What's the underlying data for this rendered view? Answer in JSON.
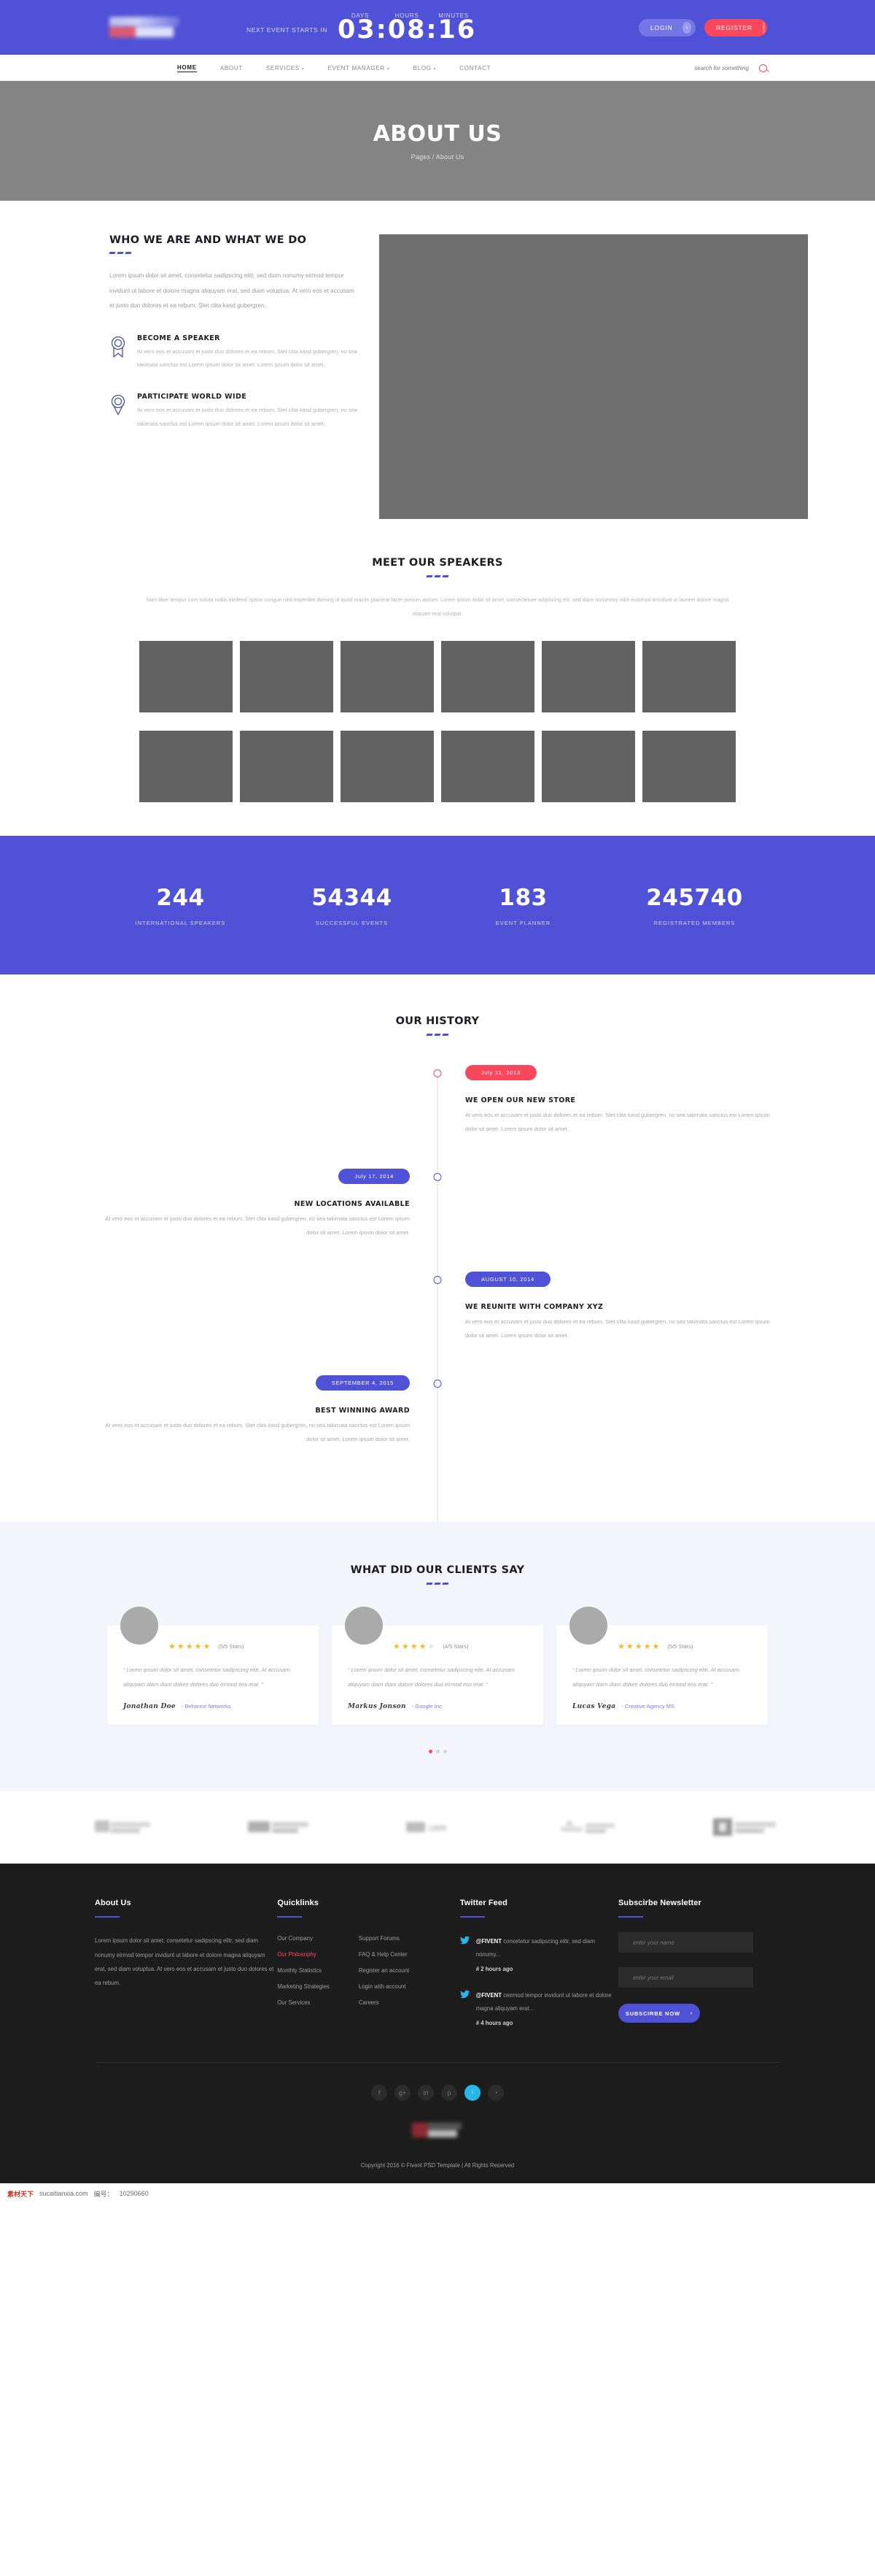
{
  "topbar": {
    "next_event_label": "NEXT EVENT STARTS IN",
    "clock": {
      "days_label": "DAYS",
      "hours_label": "HOURS",
      "minutes_label": "MINUTES",
      "time": "03:08:16"
    },
    "login_label": "LOGIN",
    "register_label": "REGISTER",
    "arrow": "›",
    "brand_color": "#4f51d6",
    "accent_color": "#f9485b"
  },
  "nav": {
    "items": [
      {
        "label": "HOME",
        "caret": "",
        "active": true
      },
      {
        "label": "ABOUT",
        "caret": "",
        "active": false
      },
      {
        "label": "SERVICES",
        "caret": "▾",
        "active": false
      },
      {
        "label": "EVENT MANAGER",
        "caret": "▾",
        "active": false
      },
      {
        "label": "BLOG",
        "caret": "▾",
        "active": false
      },
      {
        "label": "CONTACT",
        "caret": "",
        "active": false
      }
    ],
    "search_placeholder": "search for something"
  },
  "hero": {
    "title": "ABOUT US",
    "breadcrumb": "Pages / About Us"
  },
  "who": {
    "title": "WHO WE ARE AND WHAT WE DO",
    "paragraph": "Lorem ipsum dolor sit amet, consetetur sadipscing elitr, sed diam nonumy eirmod tempor invidunt ut labore et dolore magna aliquyam erat, sed diam voluptua. At vero eos et accusam et justo duo dolores et ea rebum. Stet clita kasd gubergren.",
    "features": [
      {
        "icon": "award-ribbon-icon",
        "title": "BECOME A SPEAKER",
        "text": "At vero eos et accusam et justo duo dolores et ea rebum. Stet clita kasd gubergren, no sea takimata sanctus est Lorem ipsum dolor sit amet. Lorem ipsum dolor sit amet."
      },
      {
        "icon": "map-pin-icon",
        "title": "PARTICIPATE WORLD WIDE",
        "text": "At vero eos et accusam et justo duo dolores et ea rebum. Stet clita kasd gubergren, no sea takimata sanctus est Lorem ipsum dolor sit amet. Lorem ipsum dolor sit amet."
      }
    ]
  },
  "speakers": {
    "title": "MEET OUR SPEAKERS",
    "description": "Nam liber tempor cum soluta nobis eleifend option congue nihil imperdiet doming id quod mazim placerat facer possim assum. Lorem ipsum dolor sit amet, consectetuer adipiscing elit, sed diam nonummy nibh euismod tincidunt ut laoreet dolore magna aliquam erat volutpat.",
    "count": 12
  },
  "counters": [
    {
      "number": "244",
      "label": "INTERNATIONAL SPEAKERS"
    },
    {
      "number": "54344",
      "label": "SUCCESSFUL EVENTS"
    },
    {
      "number": "183",
      "label": "EVENT PLANNER"
    },
    {
      "number": "245740",
      "label": "REGISTRATED MEMBERS"
    }
  ],
  "history": {
    "title": "OUR HISTORY",
    "items": [
      {
        "date": "July 21, 2013",
        "color": "red",
        "side": "right",
        "heading": "WE OPEN OUR NEW STORE",
        "text": "At vero eos et accusam et justo duo dolores et ea rebum. Stet clita kasd gubergren, no sea takimata sanctus est Lorem ipsum dolor sit amet. Lorem ipsum dolor sit amet."
      },
      {
        "date": "July 17, 2014",
        "color": "blue",
        "side": "left",
        "heading": "NEW LOCATIONS AVAILABLE",
        "text": "At vero eos et accusam et justo duo dolores et ea rebum. Stet clita kasd gubergren, no sea takimata sanctus est Lorem ipsum dolor sit amet. Lorem ipsum dolor sit amet."
      },
      {
        "date": "AUGUST 10, 2014",
        "color": "blue",
        "side": "right",
        "heading": "WE REUNITE WITH COMPANY XYZ",
        "text": "At vero eos et accusam et justo duo dolores et ea rebum. Stet clita kasd gubergren, no sea takimata sanctus est Lorem ipsum dolor sit amet. Lorem ipsum dolor sit amet."
      },
      {
        "date": "SEPTEMBER 4, 2015",
        "color": "blue",
        "side": "left",
        "heading": "BEST WINNING AWARD",
        "text": "At vero eos et accusam et justo duo dolores et ea rebum. Stet clita kasd gubergren, no sea takimata sanctus est Lorem ipsum dolor sit amet. Lorem ipsum dolor sit amet."
      }
    ]
  },
  "testimonials": {
    "title": "WHAT DID OUR CLIENTS SAY",
    "items": [
      {
        "stars": 5,
        "rating": "(5/5 Stars)",
        "quote": "“ Lorem ipsum dolor sit amet, consetetur sadipscing elitr, At accusam aliquyam diam diam dolore dolores duo eirmod eos erat. ”",
        "name": "Jonathan Doe",
        "company": "- Behance Networks"
      },
      {
        "stars": 4,
        "rating": "(4/5 Stars)",
        "quote": "“ Lorem ipsum dolor sit amet, consetetur sadipscing elitr, At accusam aliquyam diam diam dolore dolores duo eirmod eos erat. ”",
        "name": "Markus Jonson",
        "company": "- Google Inc."
      },
      {
        "stars": 5,
        "rating": "(5/5 Stars)",
        "quote": "“ Lorem ipsum dolor sit amet, consetetur sadipscing elitr, At accusam aliquyam diam diam dolore dolores duo eirmod eos erat. ”",
        "name": "Lucas Vega",
        "company": "- Creative Agency MS"
      }
    ],
    "dots": [
      true,
      false,
      false
    ]
  },
  "brands": {
    "count": 5,
    "label_1995": "1995"
  },
  "footer": {
    "about": {
      "heading": "About Us",
      "text": "Lorem ipsum dolor sit amet, consetetur sadipscing elitr, sed diam nonumy eirmod tempor invidunt ut labore et dolore magna aliquyam erat, sed diam voluptua. At vero eos et accusam et justo duo dolores et ea rebum."
    },
    "quicklinks": {
      "heading": "Quicklinks",
      "col1": [
        {
          "label": "Our Company",
          "highlight": false
        },
        {
          "label": "Our Philosophy",
          "highlight": true
        },
        {
          "label": "Monthly Statistics",
          "highlight": false
        },
        {
          "label": "Marketing Strategies",
          "highlight": false
        },
        {
          "label": "Our Services",
          "highlight": false
        }
      ],
      "col2": [
        {
          "label": "Support Forums",
          "highlight": false
        },
        {
          "label": "FAQ & Help Center",
          "highlight": false
        },
        {
          "label": "Register an account",
          "highlight": false
        },
        {
          "label": "Login with account",
          "highlight": false
        },
        {
          "label": "Careers",
          "highlight": false
        }
      ]
    },
    "twitter": {
      "heading": "Twitter Feed",
      "items": [
        {
          "handle": "@FIVENT",
          "text": " consetetur sadipscing elitr, sed diam nonumy...",
          "time": "# 2 hours ago"
        },
        {
          "handle": "@FIVENT",
          "text": " ceirmod tempor invidunt ut labore et dolore magna aliquyam erat...",
          "time": "# 4 hours ago"
        }
      ]
    },
    "newsletter": {
      "heading": "Subscirbe Newsletter",
      "name_placeholder": "enter your name",
      "email_placeholder": "enter your email",
      "button_label": "SUBSCIRBE NOW",
      "button_arrow": "›"
    },
    "socials": [
      {
        "name": "facebook",
        "glyph": "f",
        "active": false
      },
      {
        "name": "google-plus",
        "glyph": "g+",
        "active": false
      },
      {
        "name": "linkedin",
        "glyph": "in",
        "active": false
      },
      {
        "name": "pinterest",
        "glyph": "p",
        "active": false
      },
      {
        "name": "twitter",
        "glyph": "ᵗ",
        "active": true
      },
      {
        "name": "rss",
        "glyph": "◔",
        "active": false
      }
    ],
    "copyright": "Copyright 2016 © Fivent PSD Template | All Rights Reserved"
  },
  "watermark": {
    "site": "素材天下",
    "domain": "sucaitianxia.com",
    "id_label": "编号：",
    "id": "10290660"
  }
}
